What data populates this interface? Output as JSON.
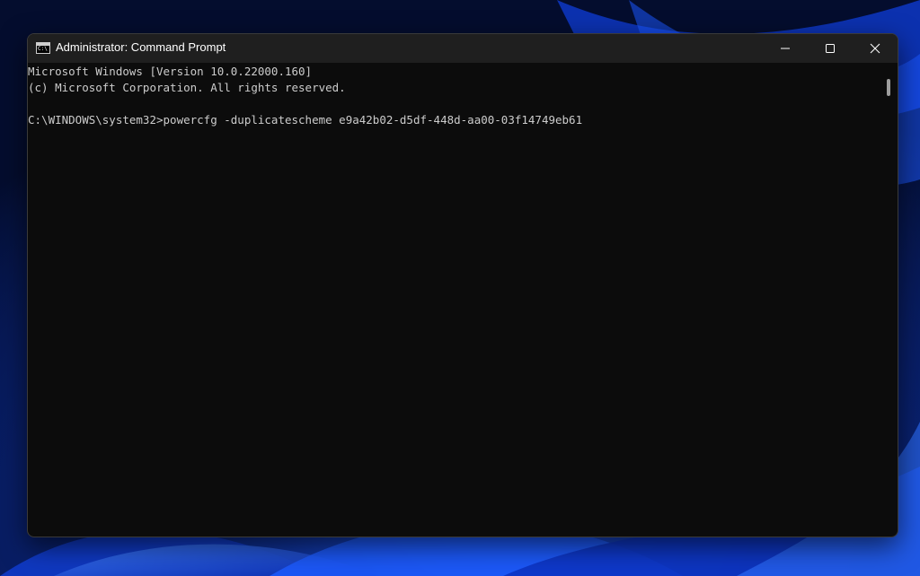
{
  "window": {
    "title": "Administrator: Command Prompt",
    "icon": "cmd-icon"
  },
  "controls": {
    "minimize": "minimize-icon",
    "maximize": "maximize-icon",
    "close": "close-icon"
  },
  "console": {
    "lines": [
      "Microsoft Windows [Version 10.0.22000.160]",
      "(c) Microsoft Corporation. All rights reserved.",
      "",
      "C:\\WINDOWS\\system32>powercfg -duplicatescheme e9a42b02-d5df-448d-aa00-03f14749eb61"
    ]
  },
  "colors": {
    "console_bg": "#0c0c0c",
    "titlebar_bg": "#1f1f1f",
    "text": "#cccccc",
    "wallpaper_accent": "#1e5bff"
  }
}
